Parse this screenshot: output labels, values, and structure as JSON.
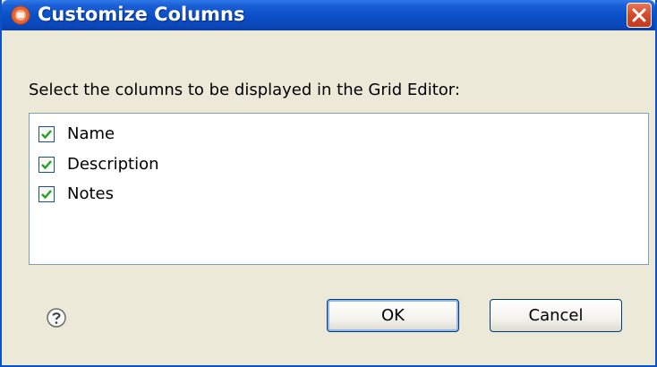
{
  "dialog": {
    "title": "Customize Columns",
    "instruction": "Select the columns to be displayed in the Grid Editor:",
    "columns": [
      {
        "label": "Name",
        "checked": true
      },
      {
        "label": "Description",
        "checked": true
      },
      {
        "label": "Notes",
        "checked": true
      }
    ],
    "buttons": {
      "ok_label": "OK",
      "cancel_label": "Cancel"
    },
    "icons": {
      "app": "app-icon",
      "close": "close-icon",
      "help": "help-icon",
      "check": "checkmark-icon"
    },
    "colors": {
      "titlebar": "#0a4ec7",
      "close": "#d34d2b",
      "check": "#21a121",
      "body": "#ece9d8"
    }
  }
}
